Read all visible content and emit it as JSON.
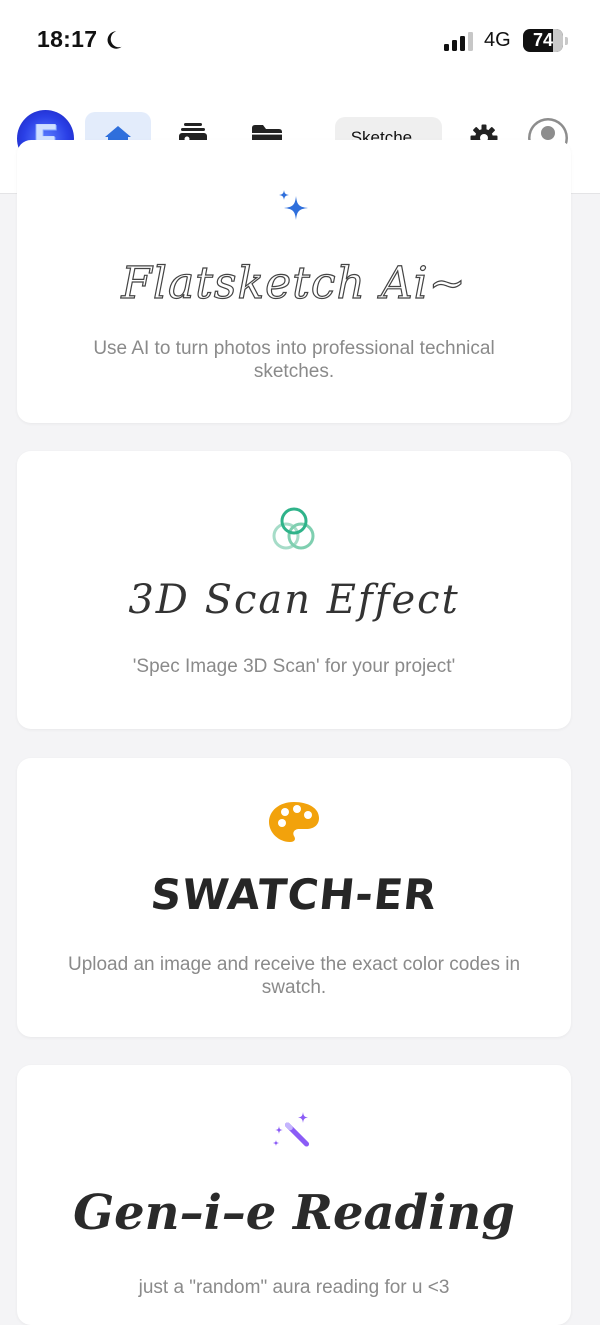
{
  "status_bar": {
    "time": "18:17",
    "network": "4G",
    "battery": "74",
    "battery_percent": 74
  },
  "header": {
    "logo_letter": "F",
    "nav": [
      {
        "name": "home",
        "icon": "home-icon",
        "active": true
      },
      {
        "name": "gallery",
        "icon": "photo-album-icon",
        "active": false
      },
      {
        "name": "folder",
        "icon": "folder-icon",
        "active": false
      }
    ],
    "project_select_value": "Sketche...",
    "settings_icon": "gear-icon",
    "profile_icon": "user-avatar-icon"
  },
  "cards": [
    {
      "id": "flatsketch",
      "icon": "sparkle-icon",
      "title": "Flatsketch Ai~",
      "description": "Use AI to turn photos into professional technical sketches."
    },
    {
      "id": "scan3d",
      "icon": "rings-icon",
      "title": "3D Scan Effect",
      "description": "'Spec Image 3D Scan' for your project'"
    },
    {
      "id": "swatcher",
      "icon": "palette-icon",
      "title": "SWATCH-ER",
      "description": "Upload an image and receive the exact color codes in swatch."
    },
    {
      "id": "genie",
      "icon": "magic-wand-icon",
      "title": "Gen–i–e Reading",
      "description": "just a \"random\" aura reading for u <3"
    }
  ],
  "colors": {
    "accent_blue": "#2f6fdc",
    "active_nav_bg": "#e3ecfb",
    "scan_green": "#2fb38a",
    "palette_orange": "#f2a20c",
    "wand_purple": "#8b5cf6"
  }
}
